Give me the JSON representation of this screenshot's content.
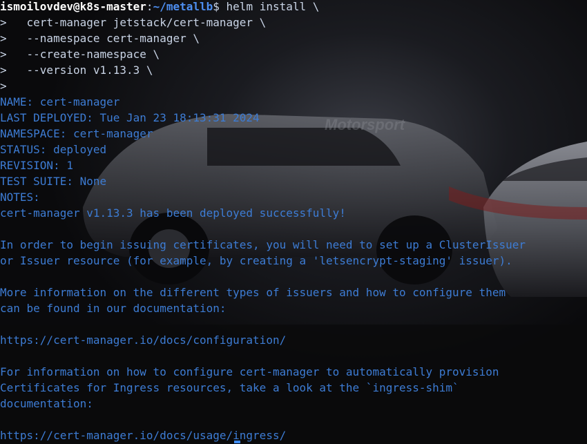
{
  "prompt": {
    "user_host": "ismoilovdev@k8s-master",
    "separator": ":",
    "path": "~/metallb",
    "sign": "$",
    "command": " helm install \\"
  },
  "continuation_lines": [
    ">   cert-manager jetstack/cert-manager \\",
    ">   --namespace cert-manager \\",
    ">   --create-namespace \\",
    ">   --version v1.13.3 \\",
    ">"
  ],
  "output_lines": [
    "NAME: cert-manager",
    "LAST DEPLOYED: Tue Jan 23 18:13:31 2024",
    "NAMESPACE: cert-manager",
    "STATUS: deployed",
    "REVISION: 1",
    "TEST SUITE: None",
    "NOTES:",
    "cert-manager v1.13.3 has been deployed successfully!",
    "",
    "In order to begin issuing certificates, you will need to set up a ClusterIssuer",
    "or Issuer resource (for example, by creating a 'letsencrypt-staging' issuer).",
    "",
    "More information on the different types of issuers and how to configure them",
    "can be found in our documentation:",
    "",
    "https://cert-manager.io/docs/configuration/",
    "",
    "For information on how to configure cert-manager to automatically provision",
    "Certificates for Ingress resources, take a look at the `ingress-shim`",
    "documentation:",
    "",
    "https://cert-manager.io/docs/usage/ingress/"
  ],
  "background": {
    "wallpaper_text": "Motorsport"
  }
}
